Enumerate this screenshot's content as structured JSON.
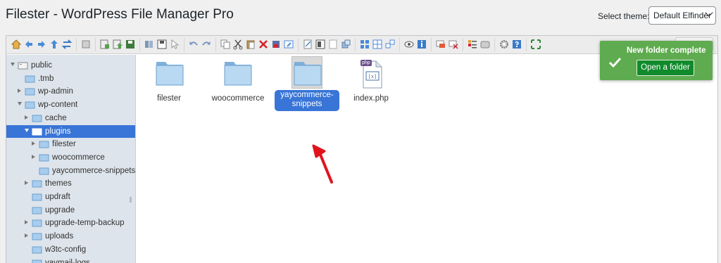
{
  "page": {
    "title": "Filester - WordPress File Manager Pro"
  },
  "theme": {
    "label": "Select theme:",
    "value": "Default Elfinder"
  },
  "tree": [
    {
      "label": "public",
      "state": "expanded"
    },
    {
      "label": ".tmb",
      "state": "none"
    },
    {
      "label": "wp-admin",
      "state": "collapsed"
    },
    {
      "label": "wp-content",
      "state": "expanded"
    },
    {
      "label": "cache",
      "state": "collapsed"
    },
    {
      "label": "plugins",
      "state": "expanded",
      "selected": true
    },
    {
      "label": "filester",
      "state": "collapsed"
    },
    {
      "label": "woocommerce",
      "state": "collapsed"
    },
    {
      "label": "yaycommerce-snippets",
      "state": "none"
    },
    {
      "label": "themes",
      "state": "collapsed"
    },
    {
      "label": "updraft",
      "state": "none"
    },
    {
      "label": "upgrade",
      "state": "none"
    },
    {
      "label": "upgrade-temp-backup",
      "state": "collapsed"
    },
    {
      "label": "uploads",
      "state": "collapsed"
    },
    {
      "label": "w3tc-config",
      "state": "none"
    },
    {
      "label": "yaymail-logs",
      "state": "none"
    }
  ],
  "files": [
    {
      "name": "filester",
      "type": "folder"
    },
    {
      "name": "woocommerce",
      "type": "folder"
    },
    {
      "name": "yaycommerce-snippets",
      "line1": "yaycommerce-",
      "line2": "snippets",
      "type": "folder",
      "selected": true
    },
    {
      "name": "index.php",
      "type": "php",
      "badge": "php"
    }
  ],
  "toast": {
    "message": "New folder complete",
    "button": "Open a folder"
  },
  "colors": {
    "selection": "#3875d7",
    "toast_bg": "#5fab4f",
    "toast_button": "#118a2c",
    "annotation": "#e0141e"
  }
}
